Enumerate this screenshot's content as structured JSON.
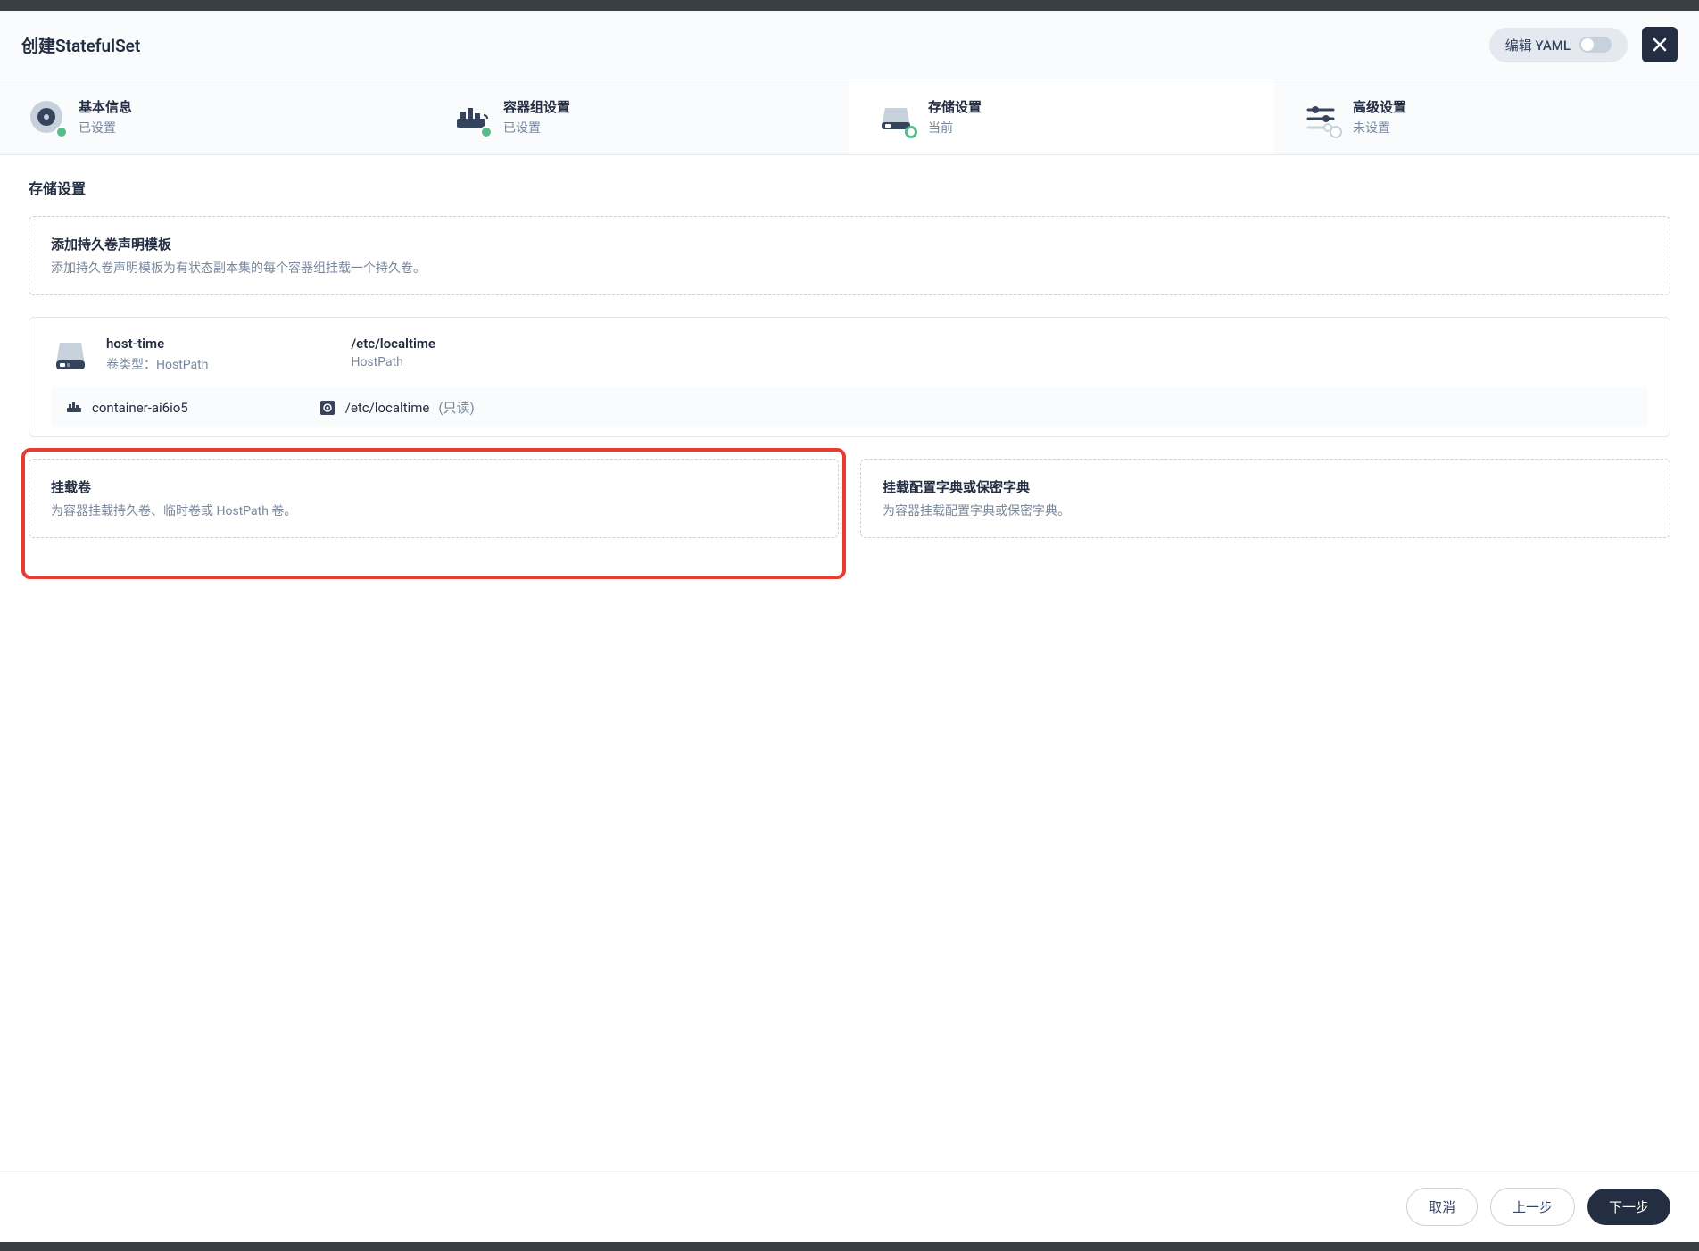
{
  "header": {
    "title": "创建StatefulSet",
    "yaml_label": "编辑 YAML"
  },
  "steps": [
    {
      "title": "基本信息",
      "status": "已设置",
      "state": "done"
    },
    {
      "title": "容器组设置",
      "status": "已设置",
      "state": "done"
    },
    {
      "title": "存储设置",
      "status": "当前",
      "state": "current"
    },
    {
      "title": "高级设置",
      "status": "未设置",
      "state": "pending"
    }
  ],
  "section": {
    "title": "存储设置"
  },
  "pvc_template": {
    "title": "添加持久卷声明模板",
    "desc": "添加持久卷声明模板为有状态副本集的每个容器组挂载一个持久卷。"
  },
  "volume": {
    "name": "host-time",
    "type_label": "卷类型：",
    "type_value": "HostPath",
    "path": "/etc/localtime",
    "path_type": "HostPath",
    "mount": {
      "container": "container-ai6io5",
      "path": "/etc/localtime",
      "mode": "(只读)"
    }
  },
  "mount_volume": {
    "title": "挂载卷",
    "desc": "为容器挂载持久卷、临时卷或 HostPath 卷。"
  },
  "mount_config": {
    "title": "挂载配置字典或保密字典",
    "desc": "为容器挂载配置字典或保密字典。"
  },
  "footer": {
    "cancel": "取消",
    "prev": "上一步",
    "next": "下一步"
  }
}
